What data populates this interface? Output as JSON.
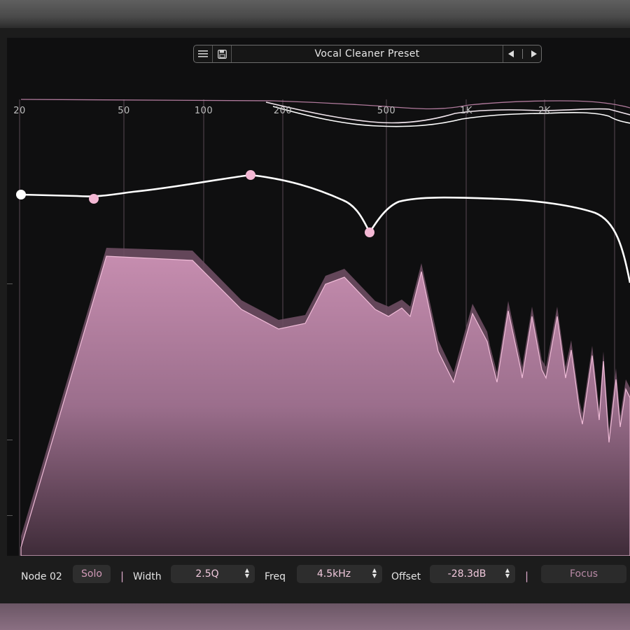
{
  "preset": {
    "name": "Vocal Cleaner Preset",
    "menu_icon": "hamburger-menu-icon",
    "save_icon": "floppy-disk-icon",
    "prev_icon": "triangle-left-icon",
    "next_icon": "triangle-right-icon"
  },
  "frequency_labels": [
    "20",
    "50",
    "100",
    "200",
    "500",
    "1K",
    "2K"
  ],
  "node_bar": {
    "node_label": "Node 02",
    "solo_label": "Solo",
    "width_label": "Width",
    "width_value": "2.5Q",
    "freq_label": "Freq",
    "freq_value": "4.5kHz",
    "offset_label": "Offset",
    "offset_value": "-28.3dB",
    "focus_label": "Focus",
    "separator": "|"
  },
  "colors": {
    "accent": "#f4b8d4",
    "spectrum_fill": "#b07a9c",
    "curve": "#ffffff",
    "background": "#0f0f10"
  }
}
